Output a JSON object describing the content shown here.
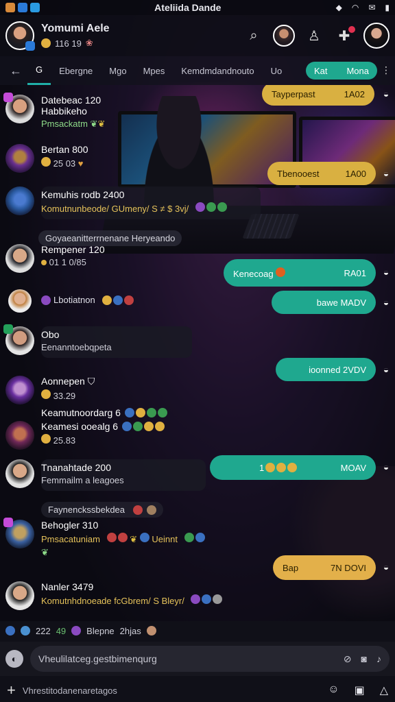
{
  "status_bar": {
    "title": "Ateliida Dande",
    "icon_names": [
      "notification-icon",
      "app-icon",
      "messenger-icon"
    ],
    "right_icon_names": [
      "bell-icon",
      "wifi-icon",
      "mail-icon",
      "battery-icon"
    ]
  },
  "header": {
    "name": "Yomumi Aele",
    "sub": "116 19",
    "icon_names": [
      "search-icon",
      "profile-icon",
      "add-contact-icon",
      "notification-icon",
      "user-avatar"
    ]
  },
  "tabs": {
    "back": "←",
    "items": [
      "G",
      "Ebergne",
      "Mgo",
      "Mpes",
      "Kemdmdandnouto",
      "Uo"
    ],
    "active_index": 1,
    "pill_left": "Kat",
    "pill_right": "Mona"
  },
  "messages": [
    {
      "name": "Datebeac 120",
      "line2": "Habbikeho",
      "sub": "Pmsackatm",
      "sub_color": "green"
    },
    {
      "name": "Bertan 800",
      "sub": "25 03"
    },
    {
      "name": "Kemuhis rodb 2400",
      "sub": "Komutnunbeode/ GUmeny/ S ≠ $ 3vj/"
    },
    {
      "chip": "Goyaeanitterrnenane Heryeando"
    },
    {
      "name": "Rempener 120",
      "sub": "01 1 0/85"
    },
    {
      "name": "",
      "sub": "Lbotiatnon"
    },
    {
      "name": "Obo",
      "sub": "Eenanntoebqpeta"
    },
    {
      "name": "Aonnepen",
      "sub": "33.29"
    },
    {
      "name": "Keamutnoordarg 6",
      "sub": ""
    },
    {
      "name": "Keamesi ooealg 6",
      "sub": "25.83"
    },
    {
      "name": "Tnanahtade 200",
      "sub": "Femmailm a leagoes"
    },
    {
      "chip": "Faynenckssbekdea"
    },
    {
      "name": "Behogler 310",
      "sub": "Pmsacatuniam",
      "sub2": "Ueinnt",
      "sub_color": "yellow"
    },
    {
      "name": "Nanler 3479",
      "sub": "Komutnhdnoeade fcGbrem/ S Bleyr/",
      "sub_color": "yellow"
    }
  ],
  "outgoing": [
    {
      "left": "Tayperpast",
      "right": "1A02",
      "color": "gold"
    },
    {
      "left": "Tbenooest",
      "right": "1A00",
      "color": "gold"
    },
    {
      "left": "Kenecoag",
      "right": "RA01",
      "color": "teal"
    },
    {
      "left": "",
      "right": "bawe MADV",
      "color": "teal"
    },
    {
      "left": "",
      "right": "ioonned 2VDV",
      "color": "teal"
    },
    {
      "left": "1",
      "right": "MOAV",
      "color": "teal"
    },
    {
      "left": "Bap",
      "right": "7N DOVI",
      "color": "orange"
    }
  ],
  "footer": {
    "typing_count": "222",
    "typing_count2": "49",
    "typing_name": "Blepne",
    "typing_time": "2hjas",
    "placeholder": "Vheulilatceg.gestbimenqurg",
    "hint": "Vhrestitodanenaretagos",
    "composer_icon_names": [
      "attach-icon",
      "sticker-icon",
      "camera-icon",
      "mic-icon"
    ],
    "bottom_icon_names": [
      "plus-icon",
      "emoji-icon",
      "keyboard-icon",
      "alert-icon"
    ]
  },
  "colors": {
    "accent_teal": "#1fa88f",
    "accent_gold": "#d9b041",
    "accent_orange": "#e3b04a",
    "panel_dark": "#101018"
  }
}
